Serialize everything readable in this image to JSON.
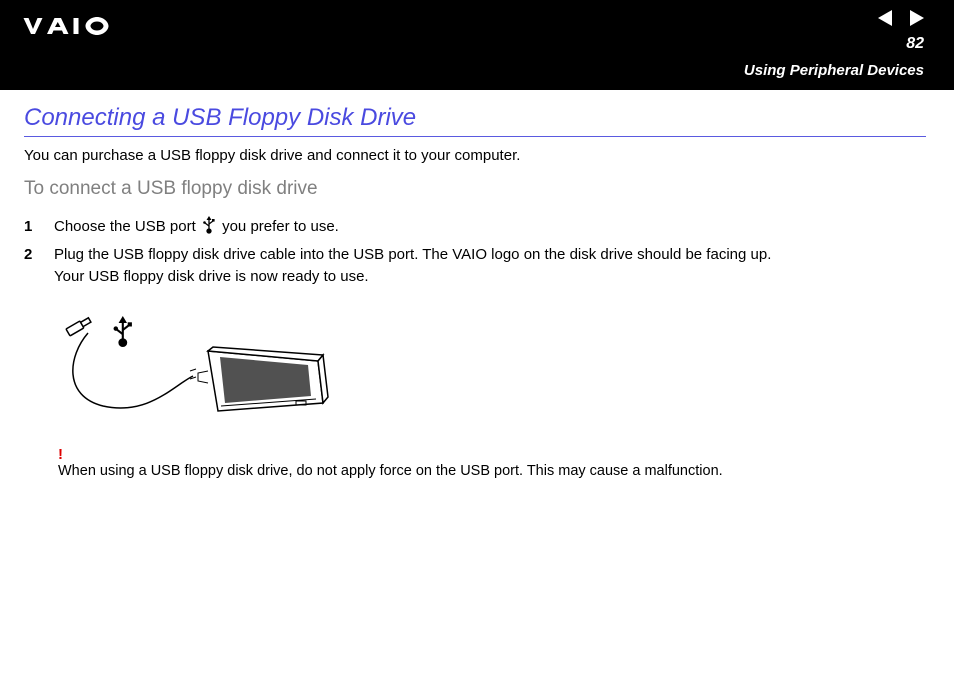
{
  "header": {
    "toc_label": "n  N",
    "page_number": "82",
    "section": "Using Peripheral Devices"
  },
  "title": "Connecting a USB Floppy Disk Drive",
  "intro": "You can purchase a USB floppy disk drive and connect it to your computer.",
  "subhead": "To connect a USB floppy disk drive",
  "steps": [
    {
      "before": "Choose the USB port ",
      "after": " you prefer to use."
    },
    {
      "line1": "Plug the USB floppy disk drive cable into the USB port. The VAIO logo on the disk drive should be facing up.",
      "line2": "Your USB floppy disk drive is now ready to use."
    }
  ],
  "caution_mark": "!",
  "caution_text": "When using a USB floppy disk drive, do not apply force on the USB port. This may cause a malfunction."
}
